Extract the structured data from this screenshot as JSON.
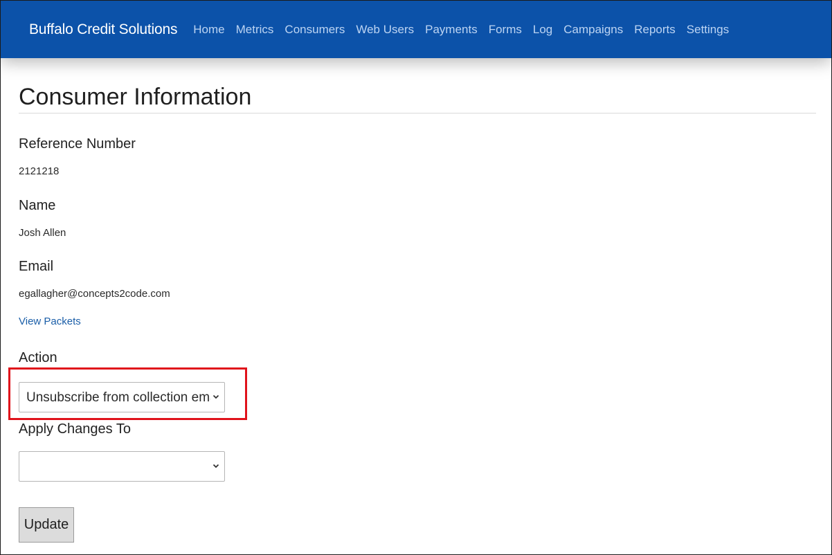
{
  "nav": {
    "brand": "Buffalo Credit Solutions",
    "links": [
      "Home",
      "Metrics",
      "Consumers",
      "Web Users",
      "Payments",
      "Forms",
      "Log",
      "Campaigns",
      "Reports",
      "Settings"
    ]
  },
  "page": {
    "title": "Consumer Information"
  },
  "consumer": {
    "reference_label": "Reference Number",
    "reference_value": "2121218",
    "name_label": "Name",
    "name_value": "Josh Allen",
    "email_label": "Email",
    "email_value": "egallagher@concepts2code.com",
    "view_packets_link": "View Packets"
  },
  "form": {
    "action_label": "Action",
    "action_selected": "Unsubscribe from collection emails",
    "apply_label": "Apply Changes To",
    "apply_selected": "",
    "update_button": "Update"
  },
  "colors": {
    "navbar": "#0c52a9",
    "highlight": "#e0121b",
    "link": "#1a5ea8"
  }
}
